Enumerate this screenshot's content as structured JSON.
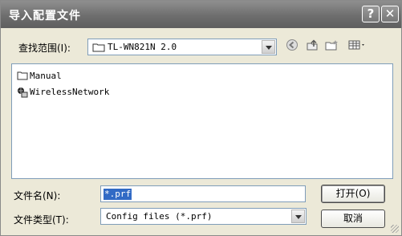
{
  "window": {
    "title": "导入配置文件"
  },
  "titlebar": {
    "help_label": "?",
    "close_label": "✕"
  },
  "lookin": {
    "label": "查找范围(I):",
    "value": "TL-WN821N 2.0"
  },
  "toolbar": {
    "back_icon": "back-icon",
    "up_icon": "up-folder-icon",
    "newfolder_icon": "new-folder-icon",
    "view_icon": "view-menu-icon"
  },
  "files": [
    {
      "name": "Manual",
      "icon": "folder-icon"
    },
    {
      "name": "WirelessNetwork",
      "icon": "network-icon"
    }
  ],
  "filename": {
    "label": "文件名(N):",
    "value": "*.prf"
  },
  "filetype": {
    "label": "文件类型(T):",
    "value": "Config files (*.prf)"
  },
  "buttons": {
    "open": "打开(O)",
    "cancel": "取消"
  }
}
